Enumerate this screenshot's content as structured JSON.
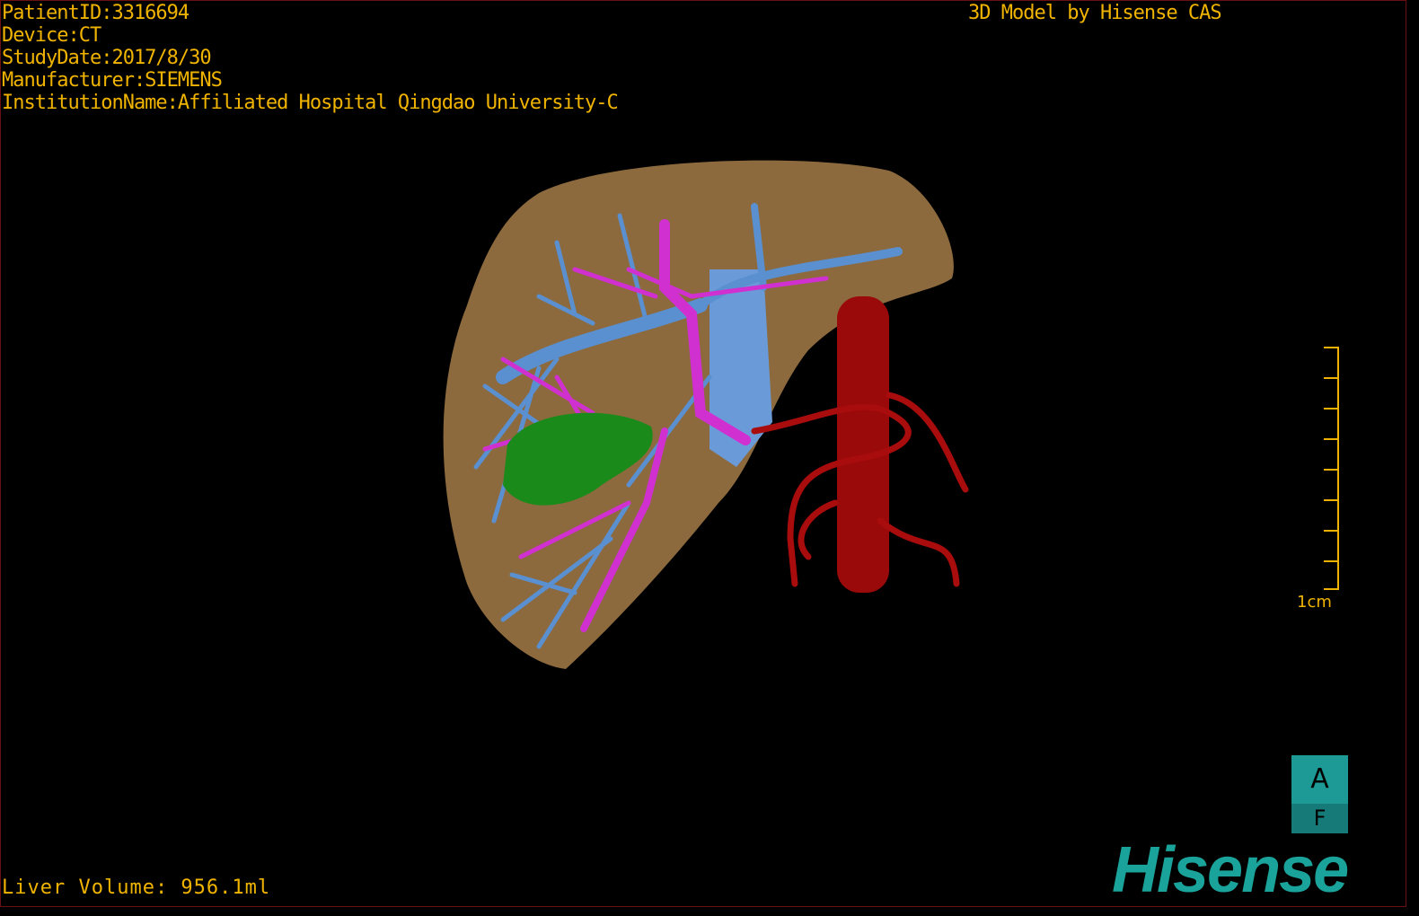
{
  "info": {
    "patient_id": "PatientID:3316694",
    "device": "Device:CT",
    "study_date": "StudyDate:2017/8/30",
    "manufacturer": "Manufacturer:SIEMENS",
    "institution": "InstitutionName:Affiliated Hospital Qingdao University-C"
  },
  "title": "3D Model by Hisense CAS",
  "liver_volume": "Liver Volume: 956.1ml",
  "scale_bar": {
    "label": "1cm"
  },
  "orientation": {
    "top": "A",
    "bottom": "F"
  },
  "logo": "Hisense",
  "colors": {
    "text": "#f0b400",
    "liver": "#8c6a3e",
    "portal_vein": "#5a8fd0",
    "bile_duct": "#d030d0",
    "gallbladder": "#1a8a1a",
    "artery": "#9a0a0a",
    "brand": "#1aa39a"
  }
}
